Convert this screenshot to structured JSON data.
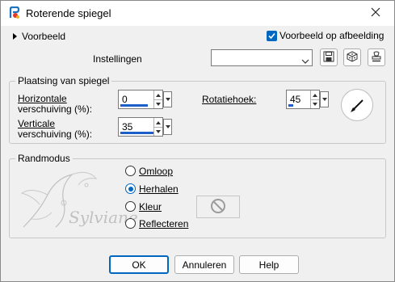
{
  "window": {
    "title": "Roterende spiegel"
  },
  "top": {
    "preview_toggle_label": "Voorbeeld",
    "preview_checkbox_label": "Voorbeeld op afbeelding",
    "preview_checked": true,
    "settings_label": "Instellingen",
    "settings_value": ""
  },
  "placement": {
    "group_title": "Plaatsing van spiegel",
    "hshift_label_line1": "Horizontale",
    "hshift_label_line2": "verschuiving (%):",
    "hshift_value": "0",
    "vshift_label_line1": "Verticale",
    "vshift_label_line2": "verschuiving (%):",
    "vshift_value": "35",
    "rotation_label": "Rotatiehoek:",
    "rotation_value": "45"
  },
  "edge_mode": {
    "group_title": "Randmodus",
    "options": [
      "Omloop",
      "Herhalen",
      "Kleur",
      "Reflecteren"
    ],
    "selected": "Herhalen"
  },
  "watermark": {
    "text": "Sylviane"
  },
  "buttons": {
    "ok": "OK",
    "cancel": "Annuleren",
    "help": "Help"
  },
  "icons": [
    "app-icon",
    "close-icon",
    "triangle-right-icon",
    "checkbox-checked-icon",
    "chevron-down-icon",
    "save-icon",
    "dice-icon",
    "stamp-icon",
    "dial-icon",
    "no-color-icon"
  ]
}
